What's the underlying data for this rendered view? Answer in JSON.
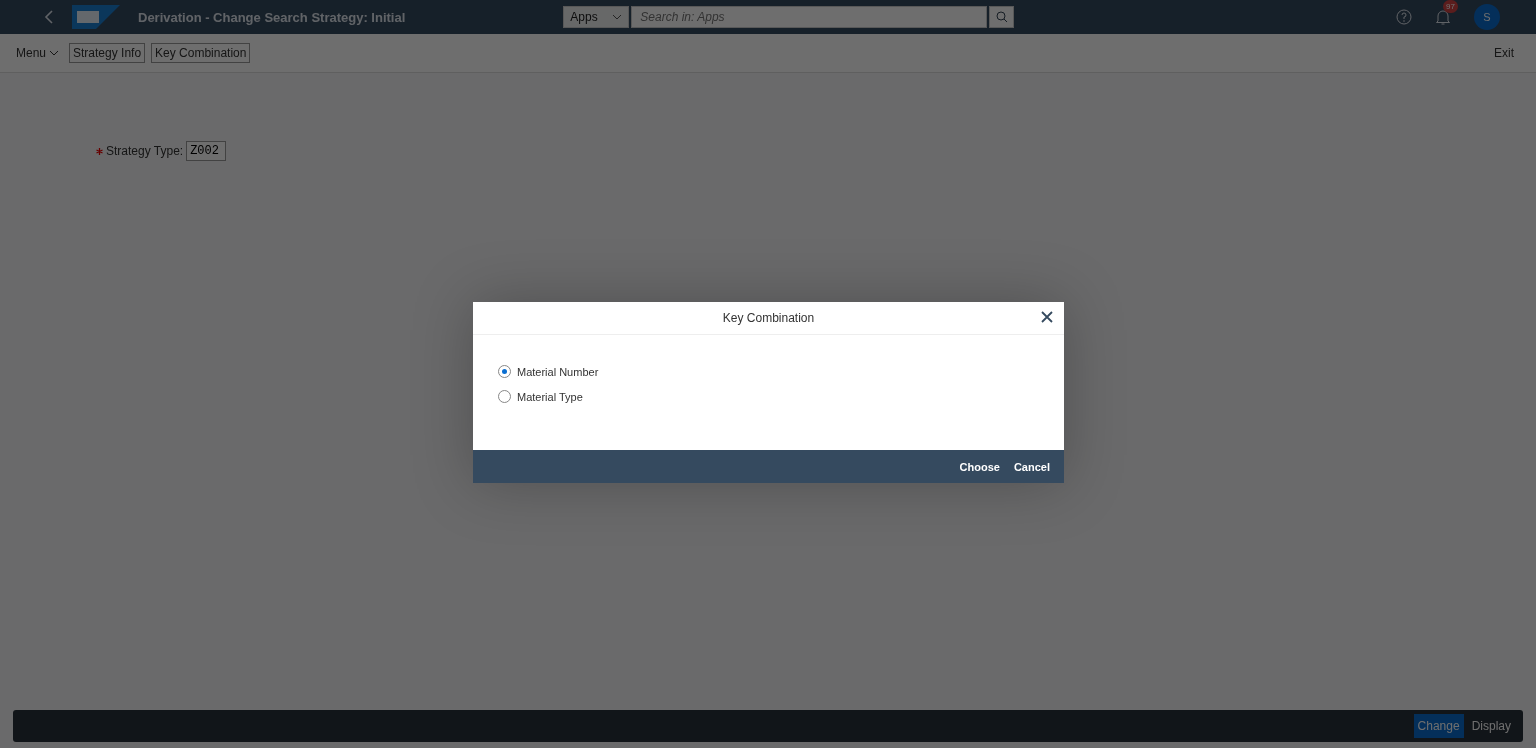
{
  "shell": {
    "title": "Derivation - Change Search Strategy: Initial",
    "scope": "Apps",
    "search": {
      "placeholder": "Search in: Apps"
    },
    "notification_count": "97",
    "avatar": "S"
  },
  "toolbar": {
    "menu": "Menu",
    "buttons": [
      "Strategy Info",
      "Key Combination"
    ],
    "exit": "Exit"
  },
  "form": {
    "label": "Strategy Type:",
    "required": true,
    "value": "Z002"
  },
  "footer": {
    "buttons": [
      {
        "label": "Change",
        "selected": true
      },
      {
        "label": "Display",
        "selected": false
      }
    ]
  },
  "dialog": {
    "title": "Key Combination",
    "options": [
      {
        "label": "Material Number",
        "selected": true
      },
      {
        "label": "Material Type",
        "selected": false
      }
    ],
    "buttons": [
      "Choose",
      "Cancel"
    ]
  }
}
